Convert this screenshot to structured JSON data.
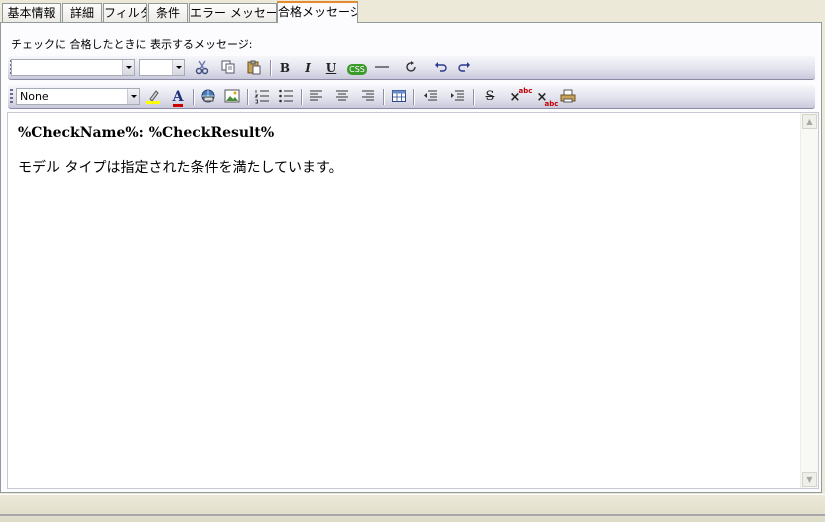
{
  "tabs": [
    {
      "label": "基本情報",
      "active": false
    },
    {
      "label": "詳細",
      "active": false
    },
    {
      "label": "フィルタ",
      "active": false
    },
    {
      "label": "条件",
      "active": false
    },
    {
      "label": "エラー メッセージ",
      "active": false
    },
    {
      "label": "合格メッセージ",
      "active": true
    }
  ],
  "caption": "チェックに 合格したときに 表示するメッセージ:",
  "toolbar1": {
    "font_value": "",
    "size_value": "",
    "icons": [
      "cut-icon",
      "copy-icon",
      "paste-icon",
      "bold-icon",
      "italic-icon",
      "underline-icon",
      "css-icon",
      "horizontal-rule-icon",
      "refresh-icon",
      "undo-icon",
      "redo-icon"
    ],
    "bold": "B",
    "italic": "I",
    "underline": "U",
    "css": "CSS"
  },
  "toolbar2": {
    "style_value": "None",
    "icons": [
      "highlight-color-icon",
      "font-color-icon",
      "insert-link-icon",
      "insert-image-icon",
      "numbered-list-icon",
      "bullet-list-icon",
      "align-left-icon",
      "align-center-icon",
      "align-right-icon",
      "insert-table-icon",
      "outdent-icon",
      "indent-icon",
      "strikethrough-icon",
      "superscript-icon",
      "subscript-icon",
      "print-icon"
    ],
    "font_color_letter": "A",
    "strike_letter": "S",
    "sup_text": "abc",
    "sub_text": "abc"
  },
  "editor": {
    "line1": "%CheckName%: %CheckResult%",
    "line2": "モデル タイプは指定された条件を満たしています。"
  },
  "colors": {
    "active_tab_accent": "#e68b2c",
    "font_color_bar": "#d00000",
    "highlight_bar": "#ffff00",
    "css_badge": "#3a9a2a"
  }
}
